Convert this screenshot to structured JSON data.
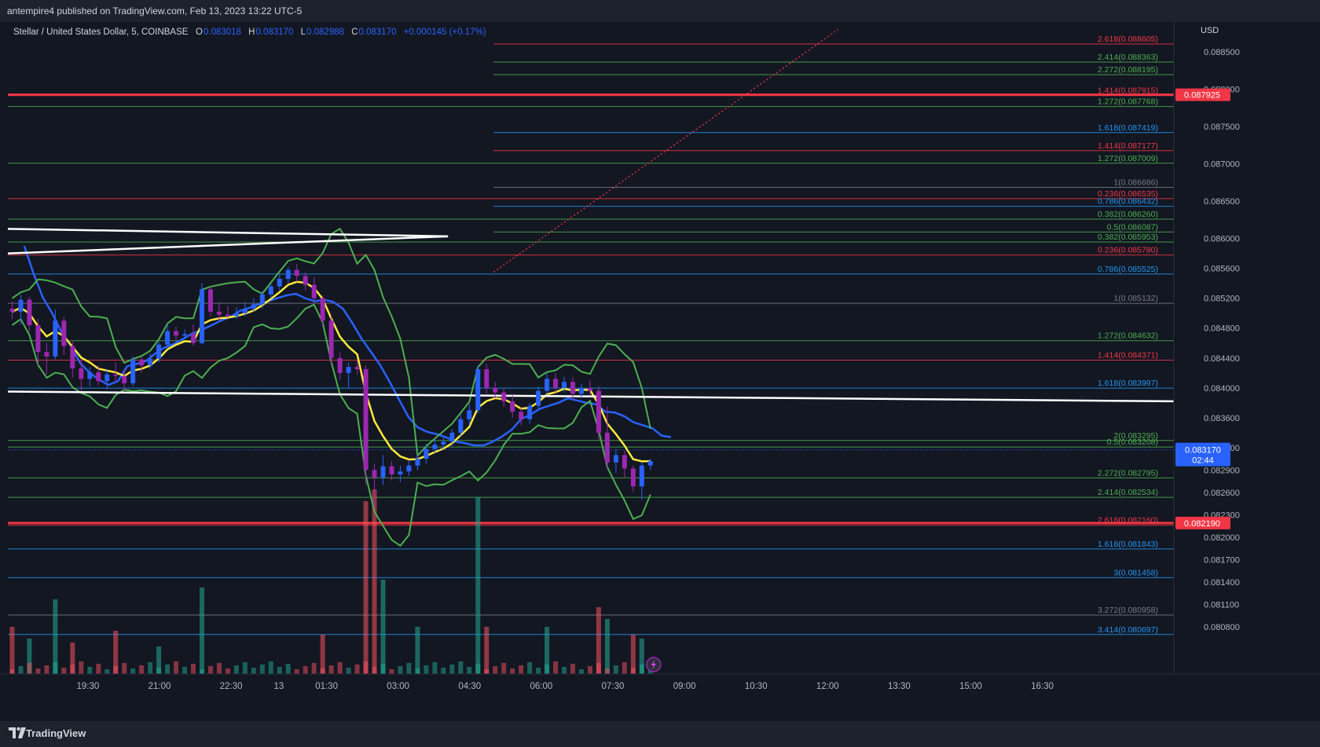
{
  "header": {
    "published": "antempire4 published on TradingView.com, Feb 13, 2023 13:22 UTC-5"
  },
  "legend": {
    "symbol": "Stellar / United States Dollar, 5, COINBASE",
    "open_label": "O",
    "open": "0.083018",
    "high_label": "H",
    "high": "0.083170",
    "low_label": "L",
    "low": "0.082988",
    "close_label": "C",
    "close": "0.083170",
    "change": "+0.000145 (+0.17%)"
  },
  "footer": {
    "brand": "TradingView"
  },
  "colors": {
    "background": "#131722",
    "grid": "#1e222d",
    "up": "#2962ff",
    "down": "#9c27b0",
    "fib_red": "#f23645",
    "fib_green": "#4caf50",
    "fib_blue": "#2196f3",
    "fib_gray": "#787b86",
    "sma": "#2962ff",
    "ema": "#ffeb3b",
    "bollinger": "#4caf50",
    "trendline": "#ffffff",
    "volume_up": "#22ab94",
    "volume_down": "#f7525f"
  },
  "chart_data": {
    "type": "candlestick",
    "currency": "USD",
    "ylim": [
      0.0804,
      0.0889
    ],
    "y_ticks": [
      "0.088500",
      "0.088000",
      "0.087500",
      "0.087000",
      "0.086500",
      "0.086000",
      "0.085600",
      "0.085200",
      "0.084800",
      "0.084400",
      "0.084000",
      "0.083600",
      "0.083200",
      "0.082900",
      "0.082600",
      "0.082300",
      "0.082000",
      "0.081700",
      "0.081400",
      "0.081100",
      "0.080800"
    ],
    "x_ticks": [
      "19:30",
      "21:00",
      "22:30",
      "13",
      "01:30",
      "03:00",
      "04:30",
      "06:00",
      "07:30",
      "09:00",
      "10:30",
      "12:00",
      "13:30",
      "15:00",
      "16:30"
    ],
    "x_tick_pos": [
      0.5,
      2,
      3.5,
      4.5,
      5.5,
      7,
      8.5,
      10,
      11.5,
      13,
      14.5,
      16,
      17.5,
      19,
      20.5
    ],
    "x_range": [
      -0.66,
      21.33
    ],
    "current_price": {
      "value": "0.083170",
      "countdown": "02:44"
    },
    "price_lines": [
      {
        "label": "0.087925",
        "value": 0.087925
      },
      {
        "label": "0.082190",
        "value": 0.08219
      }
    ],
    "fib_levels": [
      {
        "label": "2.618(0.088605)",
        "value": 0.088605,
        "color": "red",
        "span": "right"
      },
      {
        "label": "2.414(0.088363)",
        "value": 0.088363,
        "color": "green",
        "span": "right"
      },
      {
        "label": "2.272(0.088195)",
        "value": 0.088195,
        "color": "green",
        "span": "right"
      },
      {
        "label": "1.414(0.087915)",
        "value": 0.087915,
        "color": "red",
        "span": "full"
      },
      {
        "label": "1.272(0.087768)",
        "value": 0.087768,
        "color": "green",
        "span": "full"
      },
      {
        "label": "1.618(0.087419)",
        "value": 0.087419,
        "color": "blue",
        "span": "right"
      },
      {
        "label": "1.414(0.087177)",
        "value": 0.087177,
        "color": "red",
        "span": "right"
      },
      {
        "label": "1.272(0.087009)",
        "value": 0.087009,
        "color": "green",
        "span": "full"
      },
      {
        "label": "1(0.086686)",
        "value": 0.086686,
        "color": "gray",
        "span": "right"
      },
      {
        "label": "0.236(0.086535)",
        "value": 0.086535,
        "color": "red",
        "span": "full"
      },
      {
        "label": "0.786(0.086432)",
        "value": 0.086432,
        "color": "blue",
        "span": "right"
      },
      {
        "label": "0.382(0.086260)",
        "value": 0.08626,
        "color": "green",
        "span": "full"
      },
      {
        "label": "0.5(0.086087)",
        "value": 0.086087,
        "color": "green",
        "span": "right"
      },
      {
        "label": "0.382(0.085953)",
        "value": 0.085953,
        "color": "green",
        "span": "full"
      },
      {
        "label": "0.236(0.085780)",
        "value": 0.08578,
        "color": "red",
        "span": "full"
      },
      {
        "label": "0.786(0.085525)",
        "value": 0.085525,
        "color": "blue",
        "span": "full"
      },
      {
        "label": "1(0.085132)",
        "value": 0.085132,
        "color": "gray",
        "span": "full"
      },
      {
        "label": "1.272(0.084632)",
        "value": 0.084632,
        "color": "green",
        "span": "full"
      },
      {
        "label": "1.414(0.084371)",
        "value": 0.084371,
        "color": "red",
        "span": "full"
      },
      {
        "label": "1.618(0.083997)",
        "value": 0.083997,
        "color": "blue",
        "span": "full"
      },
      {
        "label": "2(0.083295)",
        "value": 0.083295,
        "color": "green",
        "span": "full"
      },
      {
        "label": "0.5(0.083208)",
        "value": 0.083208,
        "color": "green",
        "span": "full"
      },
      {
        "label": "2.272(0.082795)",
        "value": 0.082795,
        "color": "green",
        "span": "full"
      },
      {
        "label": "2.414(0.082534)",
        "value": 0.082534,
        "color": "green",
        "span": "full"
      },
      {
        "label": "2.618(0.082160)",
        "value": 0.08216,
        "color": "red",
        "span": "full"
      },
      {
        "label": "1.618(0.081843)",
        "value": 0.081843,
        "color": "blue",
        "span": "full"
      },
      {
        "label": "3(0.081458)",
        "value": 0.081458,
        "color": "blue",
        "span": "full"
      },
      {
        "label": "3.272(0.080958)",
        "value": 0.080958,
        "color": "gray",
        "span": "full"
      },
      {
        "label": "3.414(0.080697)",
        "value": 0.080697,
        "color": "blue",
        "span": "full"
      }
    ],
    "trendlines": [
      {
        "x": [
          -0.66,
          7.64
        ],
        "y": [
          0.08613,
          0.08603
        ]
      },
      {
        "x": [
          -0.66,
          7.64
        ],
        "y": [
          0.0858,
          0.08603
        ]
      },
      {
        "x": [
          -0.66,
          21.33
        ],
        "y": [
          0.08395,
          0.08382
        ]
      },
      {
        "x": [
          8.5,
          15.0
        ],
        "y": [
          0.08555,
          0.0888
        ],
        "style": "dotted-red"
      }
    ],
    "ohlc": [
      [
        0.08506,
        0.08516,
        0.08492,
        0.08502
      ],
      [
        0.08502,
        0.08525,
        0.08485,
        0.08518
      ],
      [
        0.08518,
        0.08522,
        0.08476,
        0.08484
      ],
      [
        0.08484,
        0.08492,
        0.0843,
        0.08448
      ],
      [
        0.08448,
        0.0846,
        0.08418,
        0.08442
      ],
      [
        0.08442,
        0.08505,
        0.08438,
        0.0849
      ],
      [
        0.0849,
        0.08495,
        0.08444,
        0.08456
      ],
      [
        0.08456,
        0.08462,
        0.08414,
        0.08426
      ],
      [
        0.08426,
        0.08438,
        0.08396,
        0.08412
      ],
      [
        0.08412,
        0.08428,
        0.08402,
        0.08421
      ],
      [
        0.08421,
        0.0843,
        0.08403,
        0.08409
      ],
      [
        0.08409,
        0.08425,
        0.08398,
        0.08418
      ],
      [
        0.08418,
        0.08434,
        0.08408,
        0.08416
      ],
      [
        0.08416,
        0.08425,
        0.08396,
        0.08406
      ],
      [
        0.08406,
        0.08442,
        0.08402,
        0.08438
      ],
      [
        0.08438,
        0.08442,
        0.0842,
        0.0843
      ],
      [
        0.0843,
        0.08446,
        0.08426,
        0.08439
      ],
      [
        0.08439,
        0.08462,
        0.08434,
        0.08458
      ],
      [
        0.08458,
        0.08485,
        0.08452,
        0.08476
      ],
      [
        0.08476,
        0.08482,
        0.08462,
        0.0847
      ],
      [
        0.0847,
        0.08478,
        0.08465,
        0.08472
      ],
      [
        0.08472,
        0.08485,
        0.08456,
        0.0846
      ],
      [
        0.0846,
        0.0854,
        0.08458,
        0.08532
      ],
      [
        0.08532,
        0.08535,
        0.08496,
        0.08502
      ],
      [
        0.08502,
        0.08515,
        0.0849,
        0.08498
      ],
      [
        0.08498,
        0.0851,
        0.08494,
        0.08496
      ],
      [
        0.08496,
        0.08508,
        0.08492,
        0.085
      ],
      [
        0.085,
        0.08515,
        0.08496,
        0.08506
      ],
      [
        0.08506,
        0.0852,
        0.08502,
        0.08512
      ],
      [
        0.08512,
        0.0853,
        0.08506,
        0.08525
      ],
      [
        0.08525,
        0.0854,
        0.0852,
        0.08536
      ],
      [
        0.08536,
        0.08552,
        0.0853,
        0.08546
      ],
      [
        0.08546,
        0.08562,
        0.0854,
        0.08558
      ],
      [
        0.08558,
        0.08566,
        0.08542,
        0.0855
      ],
      [
        0.0855,
        0.08555,
        0.0853,
        0.08538
      ],
      [
        0.08538,
        0.08548,
        0.08512,
        0.0852
      ],
      [
        0.0852,
        0.08524,
        0.08482,
        0.0849
      ],
      [
        0.0849,
        0.08496,
        0.0843,
        0.0844
      ],
      [
        0.0844,
        0.08448,
        0.0841,
        0.0842
      ],
      [
        0.0842,
        0.08434,
        0.084,
        0.08428
      ],
      [
        0.08428,
        0.08438,
        0.08418,
        0.08425
      ],
      [
        0.08425,
        0.0843,
        0.0827,
        0.0829
      ],
      [
        0.0829,
        0.08298,
        0.0824,
        0.0828
      ],
      [
        0.0828,
        0.0831,
        0.0827,
        0.08295
      ],
      [
        0.08295,
        0.08302,
        0.08276,
        0.08284
      ],
      [
        0.08284,
        0.08296,
        0.08274,
        0.08288
      ],
      [
        0.08288,
        0.08302,
        0.08282,
        0.08296
      ],
      [
        0.08296,
        0.0831,
        0.0829,
        0.08305
      ],
      [
        0.08305,
        0.08325,
        0.08298,
        0.08318
      ],
      [
        0.08318,
        0.08332,
        0.08312,
        0.08324
      ],
      [
        0.08324,
        0.08336,
        0.08318,
        0.08328
      ],
      [
        0.08328,
        0.08345,
        0.08322,
        0.0834
      ],
      [
        0.0834,
        0.08365,
        0.08334,
        0.08358
      ],
      [
        0.08358,
        0.08378,
        0.0835,
        0.0837
      ],
      [
        0.0837,
        0.0843,
        0.08366,
        0.08425
      ],
      [
        0.08425,
        0.08432,
        0.08392,
        0.084
      ],
      [
        0.084,
        0.08408,
        0.08386,
        0.08394
      ],
      [
        0.08394,
        0.084,
        0.08374,
        0.08382
      ],
      [
        0.08382,
        0.0839,
        0.0836,
        0.08368
      ],
      [
        0.08368,
        0.08374,
        0.0835,
        0.08358
      ],
      [
        0.08358,
        0.0838,
        0.08352,
        0.08376
      ],
      [
        0.08376,
        0.08402,
        0.0837,
        0.08396
      ],
      [
        0.08396,
        0.0842,
        0.0839,
        0.08412
      ],
      [
        0.08412,
        0.0842,
        0.08392,
        0.084
      ],
      [
        0.084,
        0.08415,
        0.08394,
        0.08408
      ],
      [
        0.08408,
        0.08414,
        0.08384,
        0.08392
      ],
      [
        0.08392,
        0.08406,
        0.08386,
        0.084
      ],
      [
        0.084,
        0.0841,
        0.0839,
        0.08396
      ],
      [
        0.08396,
        0.08402,
        0.0833,
        0.0834
      ],
      [
        0.0834,
        0.08375,
        0.0829,
        0.083
      ],
      [
        0.083,
        0.08318,
        0.08286,
        0.0831
      ],
      [
        0.0831,
        0.08316,
        0.0828,
        0.08292
      ],
      [
        0.08292,
        0.08296,
        0.0826,
        0.08268
      ],
      [
        0.08268,
        0.083,
        0.0825,
        0.08296
      ],
      [
        0.08296,
        0.08305,
        0.0829,
        0.08302
      ]
    ],
    "sma": [
      0.0859,
      0.08553,
      0.08521,
      0.085,
      0.08474,
      0.08456,
      0.08433,
      0.0842,
      0.08411,
      0.08404,
      0.08409,
      0.08429,
      0.08432,
      0.08436,
      0.08446,
      0.08454,
      0.08459,
      0.08466,
      0.08473,
      0.08478,
      0.08484,
      0.0849,
      0.08495,
      0.08503,
      0.08507,
      0.08512,
      0.08516,
      0.0852,
      0.08524,
      0.08526,
      0.0852,
      0.08516,
      0.08518,
      0.08515,
      0.08506,
      0.08487,
      0.08466,
      0.08448,
      0.0843,
      0.08408,
      0.08384,
      0.08361,
      0.08347,
      0.08341,
      0.08338,
      0.08334,
      0.08328,
      0.08326,
      0.08323,
      0.08323,
      0.08328,
      0.08335,
      0.08344,
      0.08358,
      0.08364,
      0.08372,
      0.08376,
      0.0838,
      0.08386,
      0.08383,
      0.0838,
      0.08378,
      0.08368,
      0.08367,
      0.08362,
      0.08354,
      0.0835,
      0.08346,
      0.08336,
      0.08334
    ],
    "sma_x": [
      -0.66,
      -0.33,
      0,
      0.33,
      0.67,
      1,
      1.33,
      1.67,
      2,
      2.33,
      2.67,
      3,
      3.33,
      3.67,
      4,
      4.33,
      4.67,
      5,
      5.33,
      5.67,
      6,
      6.33,
      6.67,
      7,
      7.33,
      7.67,
      8,
      8.33,
      8.67,
      9,
      9.33,
      9.67,
      10,
      10.33,
      10.67,
      11,
      11.33,
      11.67,
      12,
      12.33,
      12.67,
      13,
      13.33,
      13.67,
      14,
      14.33,
      14.67,
      15,
      15.33,
      15.67,
      16,
      16.33,
      16.67,
      17,
      17.33,
      17.67,
      18,
      18.33,
      18.67,
      19,
      19.33,
      19.67,
      20,
      20.33,
      20.67,
      21,
      21.33,
      21.67,
      22,
      22.33
    ],
    "bollinger_upper_hint": "mid ± envelope",
    "ema_hint": "short EMA of close",
    "volume": [
      {
        "i": 0,
        "v": 60,
        "up": false
      },
      {
        "i": 2,
        "v": 45,
        "up": true
      },
      {
        "i": 5,
        "v": 95,
        "up": true
      },
      {
        "i": 7,
        "v": 40,
        "up": false
      },
      {
        "i": 12,
        "v": 55,
        "up": false
      },
      {
        "i": 17,
        "v": 35,
        "up": true
      },
      {
        "i": 22,
        "v": 110,
        "up": true
      },
      {
        "i": 36,
        "v": 50,
        "up": false
      },
      {
        "i": 41,
        "v": 220,
        "up": false
      },
      {
        "i": 42,
        "v": 235,
        "up": false
      },
      {
        "i": 43,
        "v": 120,
        "up": true
      },
      {
        "i": 47,
        "v": 60,
        "up": true
      },
      {
        "i": 54,
        "v": 225,
        "up": true
      },
      {
        "i": 55,
        "v": 60,
        "up": false
      },
      {
        "i": 62,
        "v": 60,
        "up": true
      },
      {
        "i": 68,
        "v": 85,
        "up": false
      },
      {
        "i": 69,
        "v": 70,
        "up": true
      },
      {
        "i": 72,
        "v": 50,
        "up": false
      },
      {
        "i": 73,
        "v": 45,
        "up": true
      }
    ]
  }
}
